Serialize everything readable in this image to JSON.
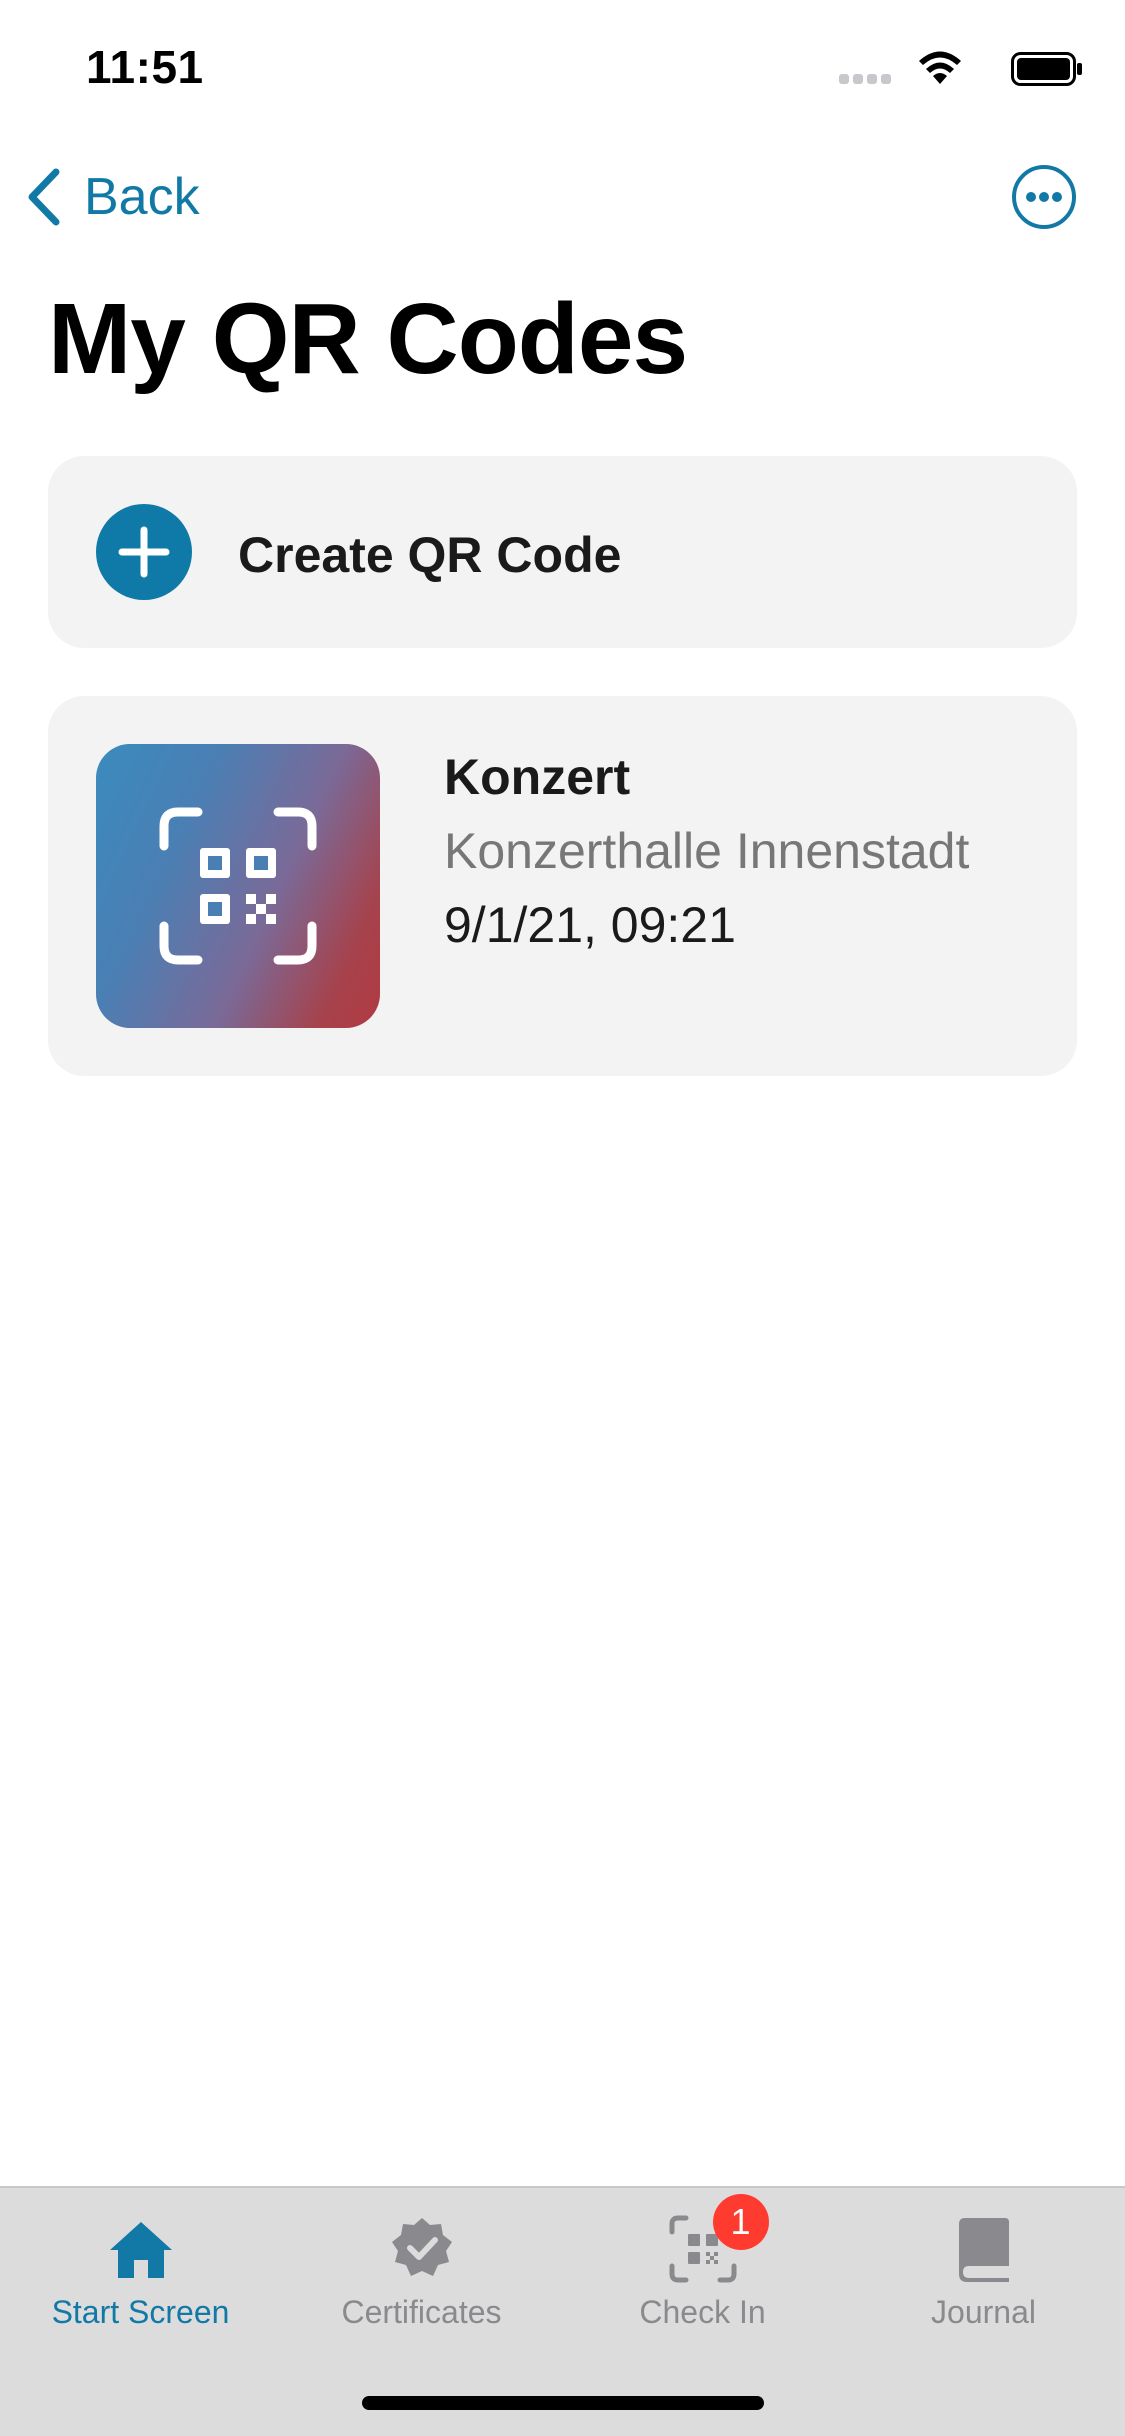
{
  "status_bar": {
    "time": "11:51"
  },
  "nav": {
    "back_label": "Back",
    "more_icon": "ellipsis-circle-icon"
  },
  "page_title": "My QR Codes",
  "create_card": {
    "label": "Create QR Code",
    "icon": "plus-circle-icon",
    "accent": "#0f7aa8"
  },
  "qr_codes": [
    {
      "title": "Konzert",
      "location": "Konzerthalle Innenstadt",
      "date": "9/1/21, 09:21",
      "icon": "qr-scan-icon"
    }
  ],
  "tab_bar": {
    "tabs": [
      {
        "label": "Start Screen",
        "icon": "home-icon",
        "active": true
      },
      {
        "label": "Certificates",
        "icon": "certificate-check-icon",
        "active": false
      },
      {
        "label": "Check In",
        "icon": "qr-scan-icon",
        "active": false,
        "badge": "1"
      },
      {
        "label": "Journal",
        "icon": "book-icon",
        "active": false
      }
    ],
    "active_color": "#1279a6",
    "inactive_color": "#8a8a8e",
    "badge_color": "#ff3b30"
  }
}
